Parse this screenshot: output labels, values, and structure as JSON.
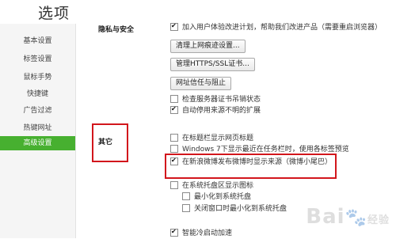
{
  "page": {
    "title": "选项"
  },
  "sidebar": {
    "items": [
      {
        "label": "基本设置",
        "active": false
      },
      {
        "label": "标签设置",
        "active": false
      },
      {
        "label": "鼠标手势",
        "active": false
      },
      {
        "label": "快捷键",
        "active": false
      },
      {
        "label": "广告过滤",
        "active": false
      },
      {
        "label": "热键网址",
        "active": false
      },
      {
        "label": "高级设置",
        "active": true
      }
    ]
  },
  "privacy": {
    "heading": "隐私与安全",
    "options": [
      {
        "label": "加入用户体验改进计划，帮助我们改进产品（需要重启浏览器）",
        "checked": true
      },
      {
        "label": "检查服务器证书吊销状态",
        "checked": false
      },
      {
        "label": "自动停用来源不明的扩展",
        "checked": true
      }
    ],
    "buttons": {
      "clear_traces": "清理上网痕迹设置...",
      "manage_https": "管理HTTPS/SSL证书...",
      "site_trust": "网址信任与阻止"
    }
  },
  "other": {
    "heading": "其它",
    "options": [
      {
        "label": "在标题栏显示网页标题",
        "checked": false
      },
      {
        "label": "Windows 7下显示最近在任务栏时，使用各标签预览",
        "checked": false
      },
      {
        "label": "在新浪微博发布微博时显示来源（微博小尾巴）",
        "checked": true
      },
      {
        "label": "在系统托盘区显示图标",
        "checked": false
      },
      {
        "label": "最小化到系统托盘",
        "checked": false
      },
      {
        "label": "关闭窗口时最小化到系统托盘",
        "checked": false
      },
      {
        "label": "智能冷启动加速",
        "checked": true
      }
    ]
  },
  "watermark": {
    "text": "Bai",
    "text2": "经验"
  },
  "colors": {
    "active_nav": "#47b030",
    "highlight_box": "#d2161c"
  }
}
